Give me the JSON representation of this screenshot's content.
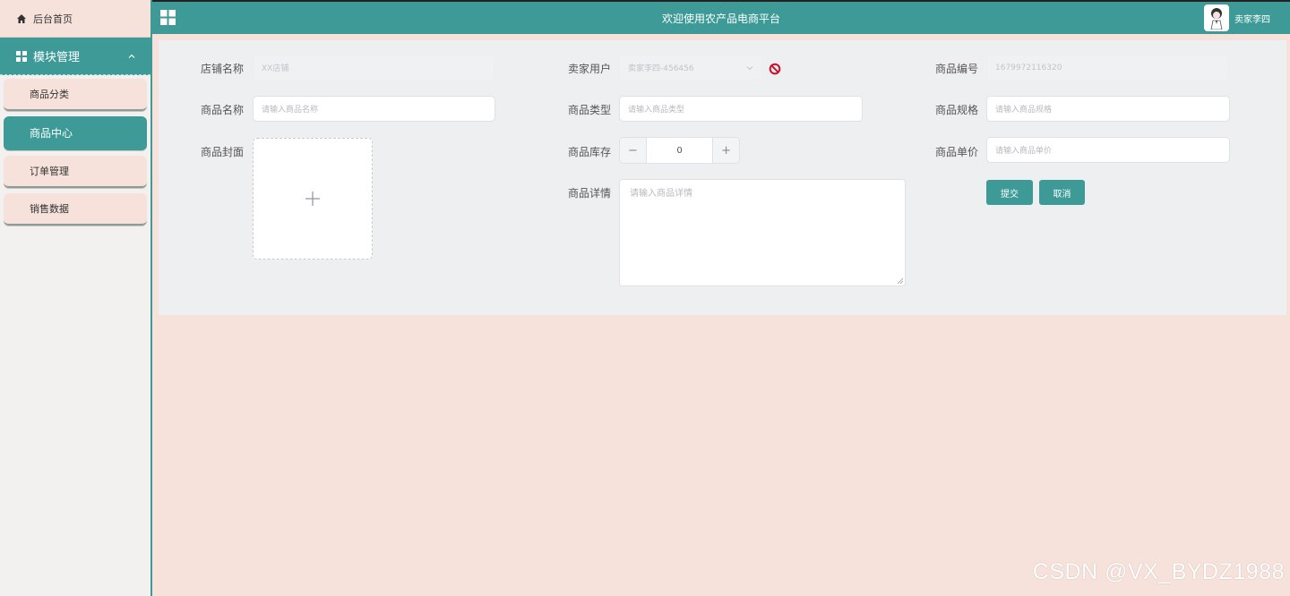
{
  "sidebar": {
    "home_label": "后台首页",
    "module_label": "模块管理",
    "items": [
      {
        "label": "商品分类",
        "active": false
      },
      {
        "label": "商品中心",
        "active": true
      },
      {
        "label": "订单管理",
        "active": false
      },
      {
        "label": "销售数据",
        "active": false
      }
    ]
  },
  "header": {
    "title": "欢迎使用农产品电商平台",
    "user_name": "卖家李四"
  },
  "form": {
    "shop_name": {
      "label": "店铺名称",
      "value": "XX店铺"
    },
    "seller": {
      "label": "卖家用户",
      "value": "卖家李四-456456"
    },
    "product_no": {
      "label": "商品编号",
      "value": "1679972116320"
    },
    "product_name": {
      "label": "商品名称",
      "placeholder": "请输入商品名称"
    },
    "product_type": {
      "label": "商品类型",
      "placeholder": "请输入商品类型"
    },
    "product_spec": {
      "label": "商品规格",
      "placeholder": "请输入商品规格"
    },
    "cover": {
      "label": "商品封面"
    },
    "stock": {
      "label": "商品库存",
      "value": "0",
      "minus": "−",
      "plus": "+"
    },
    "unit_price": {
      "label": "商品单价",
      "placeholder": "请输入商品单价"
    },
    "detail": {
      "label": "商品详情",
      "placeholder": "请输入商品详情"
    },
    "submit_label": "提交",
    "cancel_label": "取消"
  },
  "colors": {
    "accent": "#3d9a97",
    "background": "#f6e2db",
    "panel": "#eeeff1"
  },
  "watermark": "CSDN @VX_BYDZ1988"
}
